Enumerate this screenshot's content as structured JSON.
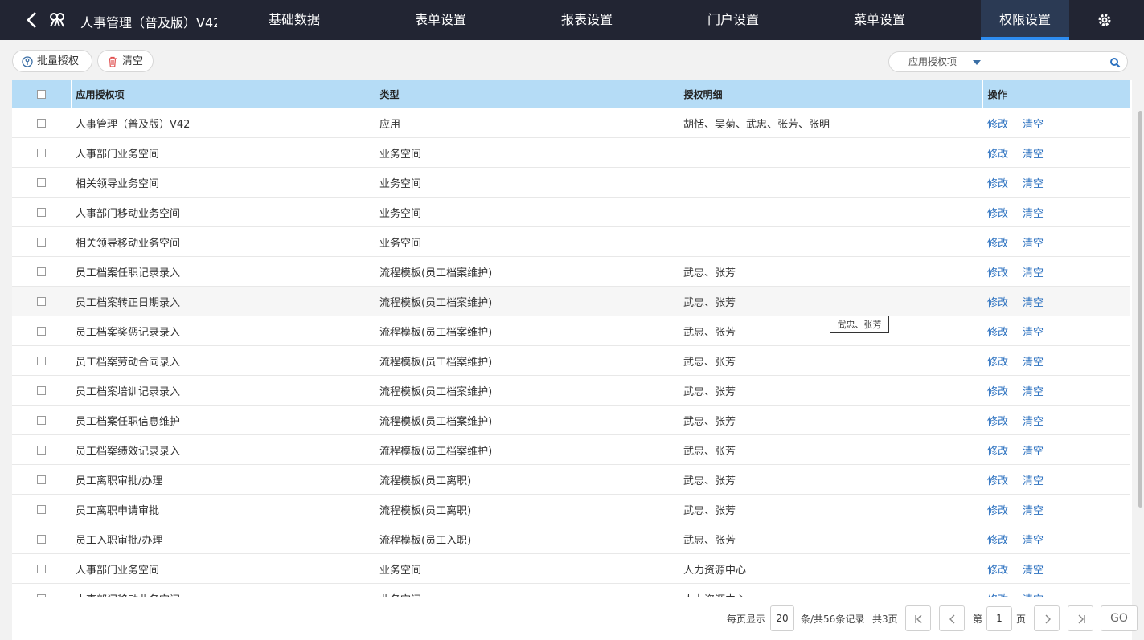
{
  "header": {
    "back_icon": "chevron-left-icon",
    "logo_icon": "app-logo-icon",
    "app_title": "人事管理（普及版）V42",
    "tabs": [
      {
        "label": "基础数据"
      },
      {
        "label": "表单设置"
      },
      {
        "label": "报表设置"
      },
      {
        "label": "门户设置"
      },
      {
        "label": "菜单设置"
      },
      {
        "label": "权限设置",
        "active": true
      }
    ],
    "settings_icon": "gear-icon"
  },
  "toolbar": {
    "batch_auth_label": "批量授权",
    "batch_auth_icon": "key-icon",
    "clear_label": "清空",
    "clear_icon": "trash-icon"
  },
  "search": {
    "field_label": "应用授权项",
    "value": "",
    "icon": "search-icon"
  },
  "table": {
    "columns": [
      "应用授权项",
      "类型",
      "授权明细",
      "操作"
    ],
    "edit_label": "修改",
    "clear_label": "清空",
    "rows": [
      {
        "item": "人事管理（普及版）V42",
        "type": "应用",
        "detail": "胡恬、吴菊、武忠、张芳、张明"
      },
      {
        "item": "人事部门业务空间",
        "type": "业务空间",
        "detail": ""
      },
      {
        "item": "相关领导业务空间",
        "type": "业务空间",
        "detail": ""
      },
      {
        "item": "人事部门移动业务空间",
        "type": "业务空间",
        "detail": ""
      },
      {
        "item": "相关领导移动业务空间",
        "type": "业务空间",
        "detail": ""
      },
      {
        "item": "员工档案任职记录录入",
        "type": "流程模板(员工档案维护)",
        "detail": "武忠、张芳"
      },
      {
        "item": "员工档案转正日期录入",
        "type": "流程模板(员工档案维护)",
        "detail": "武忠、张芳"
      },
      {
        "item": "员工档案奖惩记录录入",
        "type": "流程模板(员工档案维护)",
        "detail": "武忠、张芳"
      },
      {
        "item": "员工档案劳动合同录入",
        "type": "流程模板(员工档案维护)",
        "detail": "武忠、张芳"
      },
      {
        "item": "员工档案培训记录录入",
        "type": "流程模板(员工档案维护)",
        "detail": "武忠、张芳"
      },
      {
        "item": "员工档案任职信息维护",
        "type": "流程模板(员工档案维护)",
        "detail": "武忠、张芳"
      },
      {
        "item": "员工档案绩效记录录入",
        "type": "流程模板(员工档案维护)",
        "detail": "武忠、张芳"
      },
      {
        "item": "员工离职审批/办理",
        "type": "流程模板(员工离职)",
        "detail": "武忠、张芳"
      },
      {
        "item": "员工离职申请审批",
        "type": "流程模板(员工离职)",
        "detail": "武忠、张芳"
      },
      {
        "item": "员工入职审批/办理",
        "type": "流程模板(员工入职)",
        "detail": "武忠、张芳"
      },
      {
        "item": "人事部门业务空间",
        "type": "业务空间",
        "detail": "人力资源中心"
      },
      {
        "item": "人事部门移动业务空间",
        "type": "业务空间",
        "detail": "人力资源中心"
      }
    ]
  },
  "tooltip": "武忠、张芳",
  "pager": {
    "per_page_label": "每页显示",
    "per_page": "20",
    "total_label": "条/共56条记录",
    "pages_label": "共3页",
    "page_prefix": "第",
    "current_page": "1",
    "page_suffix": "页",
    "go_label": "GO",
    "first_icon": "first-page-icon",
    "prev_icon": "chevron-left-icon",
    "next_icon": "chevron-right-icon",
    "last_icon": "last-page-icon"
  }
}
